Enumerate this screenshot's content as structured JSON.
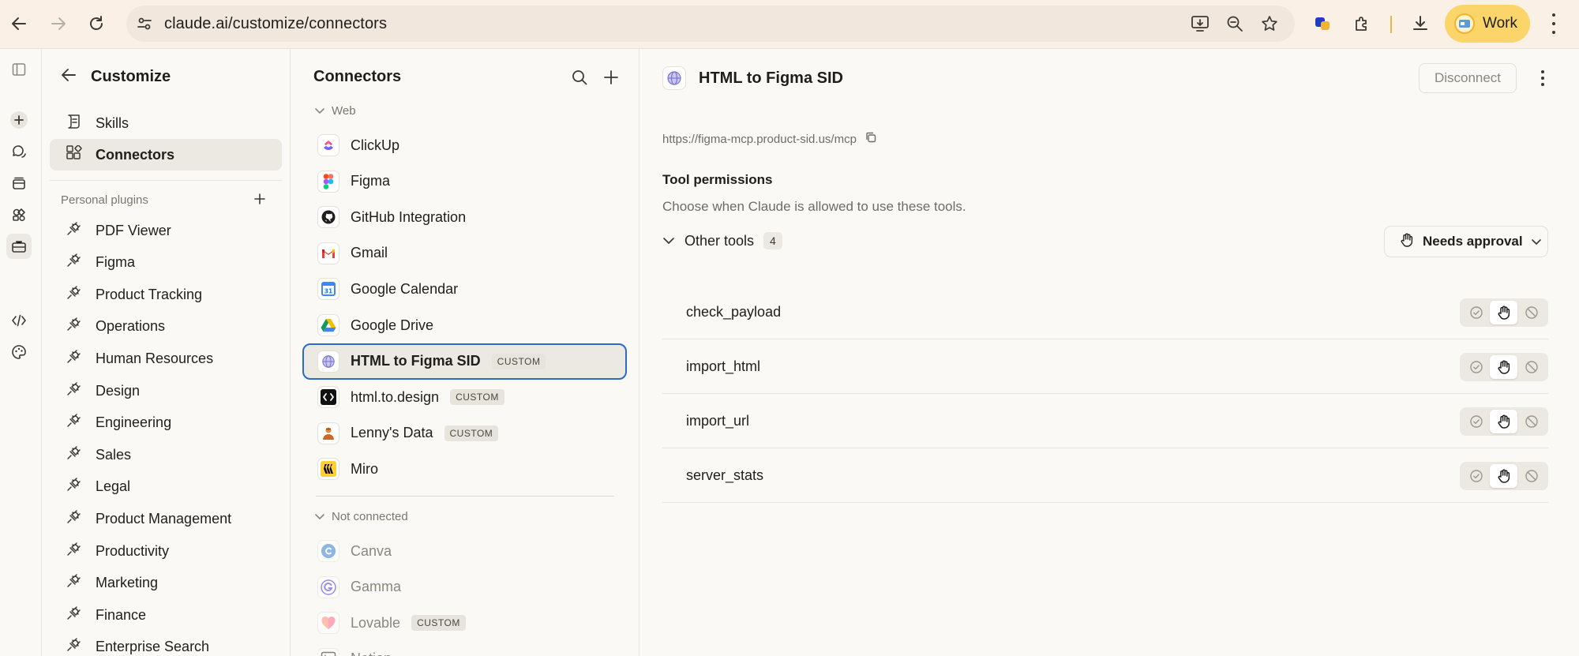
{
  "browser": {
    "url_host": "claude.ai",
    "url_path": "/customize/connectors",
    "profile_label": "Work"
  },
  "rail": {
    "items": [
      "sidebar-toggle-icon",
      "new-chat-icon",
      "chats-icon",
      "projects-icon",
      "artifacts-icon",
      "customize-icon",
      "code-icon",
      "palette-icon"
    ]
  },
  "customize": {
    "title": "Customize",
    "nav": [
      {
        "label": "Skills",
        "icon": "skills-icon"
      },
      {
        "label": "Connectors",
        "icon": "connectors-icon",
        "active": true
      }
    ],
    "plugins_section_label": "Personal plugins",
    "plugins": [
      "PDF Viewer",
      "Figma",
      "Product Tracking",
      "Operations",
      "Human Resources",
      "Design",
      "Engineering",
      "Sales",
      "Legal",
      "Product Management",
      "Productivity",
      "Marketing",
      "Finance",
      "Enterprise Search"
    ]
  },
  "connectors": {
    "title": "Connectors",
    "group_web": "Web",
    "group_not_connected": "Not connected",
    "custom_tag": "CUSTOM",
    "web_items": [
      {
        "label": "ClickUp",
        "logo": "clickup-icon"
      },
      {
        "label": "Figma",
        "logo": "figma-icon"
      },
      {
        "label": "GitHub Integration",
        "logo": "github-icon"
      },
      {
        "label": "Gmail",
        "logo": "gmail-icon"
      },
      {
        "label": "Google Calendar",
        "logo": "google-calendar-icon"
      },
      {
        "label": "Google Drive",
        "logo": "google-drive-icon"
      },
      {
        "label": "HTML to Figma SID",
        "logo": "globe-icon",
        "custom": true,
        "selected": true
      },
      {
        "label": "html.to.design",
        "logo": "html-to-design-icon",
        "custom": true
      },
      {
        "label": "Lenny's Data",
        "logo": "lenny-icon",
        "custom": true
      },
      {
        "label": "Miro",
        "logo": "miro-icon"
      }
    ],
    "not_connected_items": [
      {
        "label": "Canva",
        "logo": "canva-icon"
      },
      {
        "label": "Gamma",
        "logo": "gamma-icon"
      },
      {
        "label": "Lovable",
        "logo": "lovable-icon",
        "custom": true
      },
      {
        "label": "Notion",
        "logo": "notion-icon"
      }
    ]
  },
  "detail": {
    "title": "HTML to Figma SID",
    "disconnect_label": "Disconnect",
    "server_url": "https://figma-mcp.product-sid.us/mcp",
    "permissions_title": "Tool permissions",
    "permissions_desc": "Choose when Claude is allowed to use these tools.",
    "group_label": "Other tools",
    "group_count": "4",
    "approval_label": "Needs approval",
    "tools": [
      {
        "name": "check_payload",
        "mode": "needs-approval"
      },
      {
        "name": "import_html",
        "mode": "needs-approval"
      },
      {
        "name": "import_url",
        "mode": "needs-approval"
      },
      {
        "name": "server_stats",
        "mode": "needs-approval"
      }
    ]
  }
}
